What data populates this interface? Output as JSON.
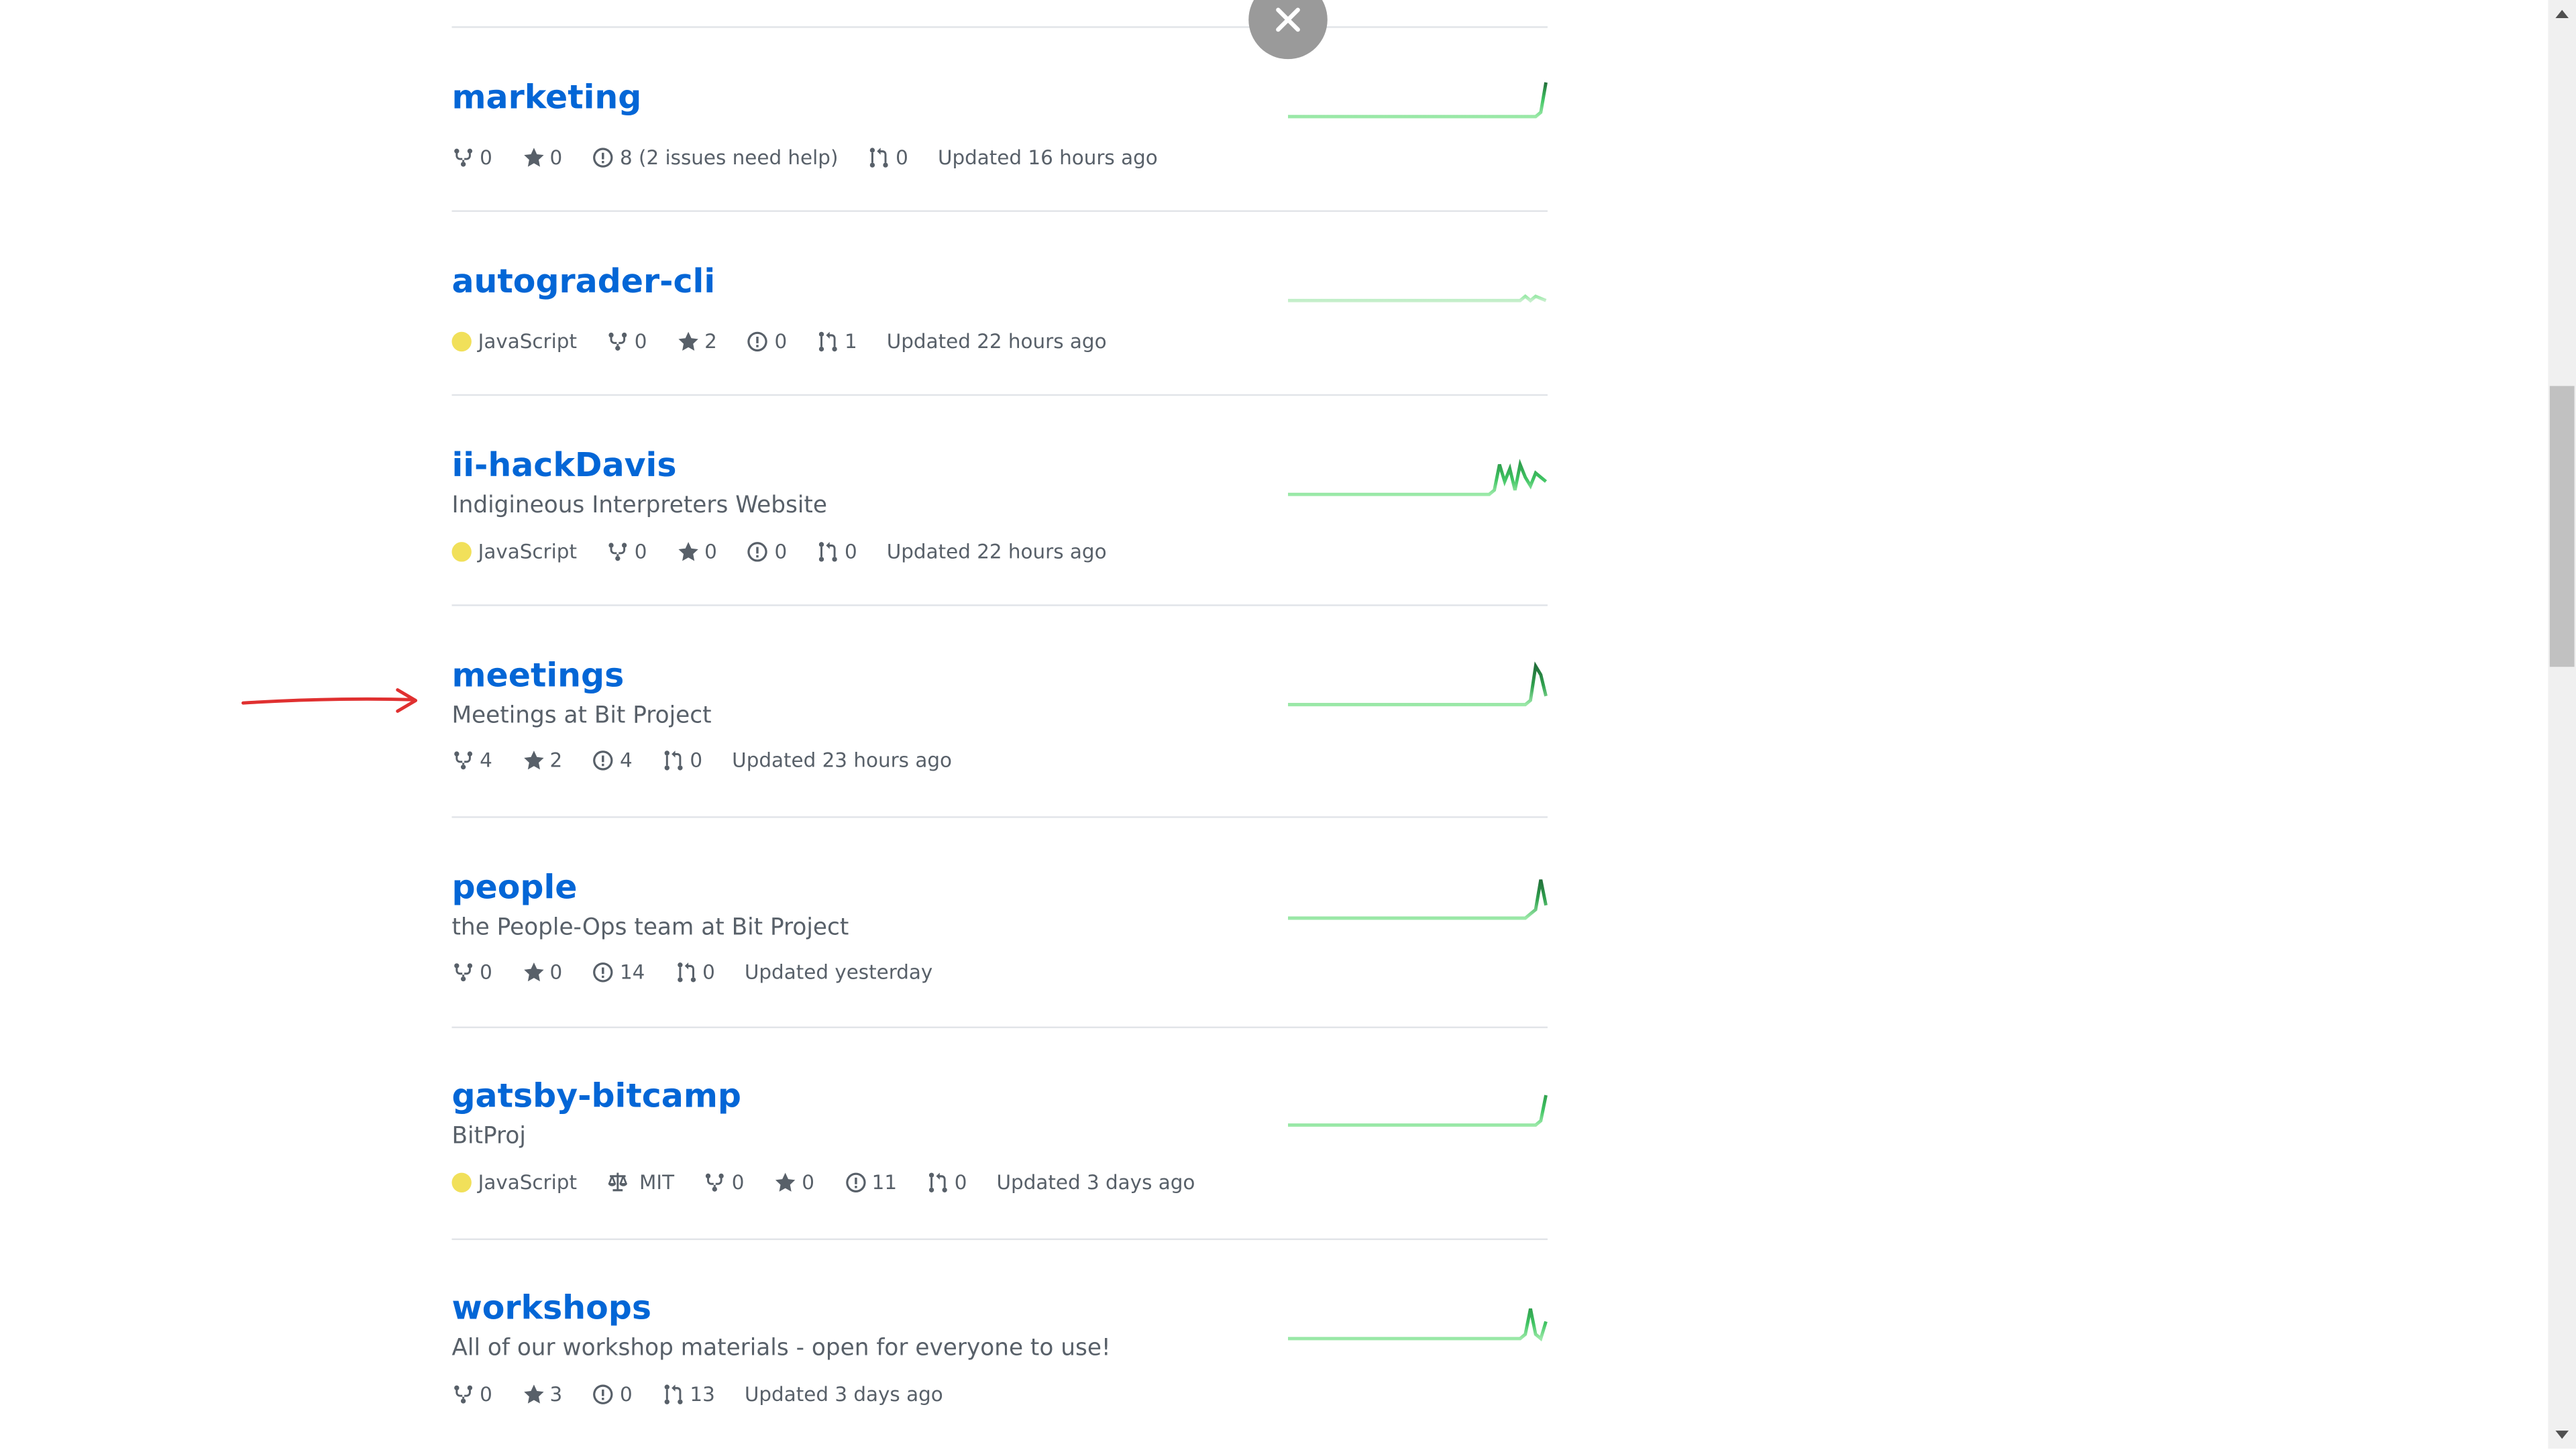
{
  "close_icon": "close-icon",
  "repos": [
    {
      "name": "marketing",
      "description": "",
      "language": "",
      "license": "",
      "forks": "0",
      "stars": "0",
      "issues": "8 (2 issues need help)",
      "pulls": "0",
      "updated": "Updated 16 hours ago",
      "spark_color": "#40c463",
      "spark": [
        0,
        0,
        0,
        0,
        0,
        0,
        0,
        0,
        0,
        0,
        0,
        0,
        0,
        0,
        0,
        0,
        0,
        0,
        0,
        0,
        0,
        0,
        0,
        0,
        0,
        0,
        0,
        0,
        0,
        0,
        0,
        0,
        0,
        0,
        0,
        0,
        0,
        0,
        0,
        0,
        0,
        0,
        0,
        0,
        0,
        0,
        0,
        0,
        0,
        1,
        8
      ]
    },
    {
      "name": "autograder-cli",
      "description": "",
      "language": "JavaScript",
      "license": "",
      "forks": "0",
      "stars": "2",
      "issues": "0",
      "pulls": "1",
      "updated": "Updated 22 hours ago",
      "spark_color": "#9be9a8",
      "spark": [
        0,
        0,
        0,
        0,
        0,
        0,
        0,
        0,
        0,
        0,
        0,
        0,
        0,
        0,
        0,
        0,
        0,
        0,
        0,
        0,
        0,
        0,
        0,
        0,
        0,
        0,
        0,
        0,
        0,
        0,
        0,
        0,
        0,
        0,
        0,
        0,
        0,
        0,
        0,
        0,
        0,
        0,
        0,
        0,
        0,
        0,
        1,
        0,
        1,
        0.5,
        0
      ]
    },
    {
      "name": "ii-hackDavis",
      "description": "Indigineous Interpreters Website",
      "language": "JavaScript",
      "license": "",
      "forks": "0",
      "stars": "0",
      "issues": "0",
      "pulls": "0",
      "updated": "Updated 22 hours ago",
      "spark_color": "#40c463",
      "spark": [
        0,
        0,
        0,
        0,
        0,
        0,
        0,
        0,
        0,
        0,
        0,
        0,
        0,
        0,
        0,
        0,
        0,
        0,
        0,
        0,
        0,
        0,
        0,
        0,
        0,
        0,
        0,
        0,
        0,
        0,
        0,
        0,
        0,
        0,
        0,
        0,
        0,
        0,
        0,
        0,
        1,
        7,
        3,
        6,
        1,
        7,
        4,
        2,
        5,
        4,
        3
      ]
    },
    {
      "name": "meetings",
      "description": "Meetings at Bit Project",
      "language": "",
      "license": "",
      "forks": "4",
      "stars": "2",
      "issues": "4",
      "pulls": "0",
      "updated": "Updated 23 hours ago",
      "spark_color": "#30a14e",
      "spark": [
        0,
        0,
        0,
        0,
        0,
        0,
        0,
        0,
        0,
        0,
        0,
        0,
        0,
        0,
        0,
        0,
        0,
        0,
        0,
        0,
        0,
        0,
        0,
        0,
        0,
        0,
        0,
        0,
        0,
        0,
        0,
        0,
        0,
        0,
        0,
        0,
        0,
        0,
        0,
        0,
        0,
        0,
        0,
        0,
        0,
        0,
        0,
        1,
        9,
        7,
        2
      ]
    },
    {
      "name": "people",
      "description": "the People-Ops team at Bit Project",
      "language": "",
      "license": "",
      "forks": "0",
      "stars": "0",
      "issues": "14",
      "pulls": "0",
      "updated": "Updated yesterday",
      "spark_color": "#30a14e",
      "spark": [
        0,
        0,
        0,
        0,
        0,
        0,
        0,
        0,
        0,
        0,
        0,
        0,
        0,
        0,
        0,
        0,
        0,
        0,
        0,
        0,
        0,
        0,
        0,
        0,
        0,
        0,
        0,
        0,
        0,
        0,
        0,
        0,
        0,
        0,
        0,
        0,
        0,
        0,
        0,
        0,
        0,
        0,
        0,
        0,
        0,
        0,
        0,
        1,
        2,
        9,
        3
      ]
    },
    {
      "name": "gatsby-bitcamp",
      "description": "BitProj",
      "language": "JavaScript",
      "license": "MIT",
      "forks": "0",
      "stars": "0",
      "issues": "11",
      "pulls": "0",
      "updated": "Updated 3 days ago",
      "spark_color": "#40c463",
      "spark": [
        0,
        0,
        0,
        0,
        0,
        0,
        0,
        0,
        0,
        0,
        0,
        0,
        0,
        0,
        0,
        0,
        0,
        0,
        0,
        0,
        0,
        0,
        0,
        0,
        0,
        0,
        0,
        0,
        0,
        0,
        0,
        0,
        0,
        0,
        0,
        0,
        0,
        0,
        0,
        0,
        0,
        0,
        0,
        0,
        0,
        0,
        0,
        0,
        0,
        1,
        7
      ]
    },
    {
      "name": "workshops",
      "description": "All of our workshop materials - open for everyone to use!",
      "language": "",
      "license": "",
      "forks": "0",
      "stars": "3",
      "issues": "0",
      "pulls": "13",
      "updated": "Updated 3 days ago",
      "spark_color": "#40c463",
      "spark": [
        0,
        0,
        0,
        0,
        0,
        0,
        0,
        0,
        0,
        0,
        0,
        0,
        0,
        0,
        0,
        0,
        0,
        0,
        0,
        0,
        0,
        0,
        0,
        0,
        0,
        0,
        0,
        0,
        0,
        0,
        0,
        0,
        0,
        0,
        0,
        0,
        0,
        0,
        0,
        0,
        0,
        0,
        0,
        0,
        0,
        0,
        1,
        7,
        1,
        0,
        4
      ]
    }
  ],
  "colors": {
    "link": "#0366d6",
    "javascript": "#f1e05a",
    "arrow": "#e03030"
  }
}
